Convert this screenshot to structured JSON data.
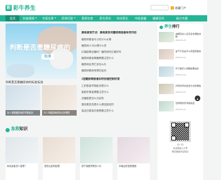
{
  "brand": {
    "logo_char": "彩",
    "name": "彩牛养生",
    "accent": "#23b595",
    "nav_active": "#168e74"
  },
  "header": {
    "favorite_label": "收藏门户"
  },
  "nav": {
    "items": [
      {
        "label": "首页",
        "active": true
      },
      {
        "label": "科普视频",
        "caret": "▼"
      },
      {
        "label": "专家文章",
        "caret": "▼"
      },
      {
        "label": "药师问答",
        "caret": "▼"
      },
      {
        "label": "营养饮食"
      },
      {
        "label": "养生资讯"
      },
      {
        "label": "科学养生"
      },
      {
        "label": "中医保健"
      },
      {
        "label": "健康百科"
      },
      {
        "label": "秘方专题"
      }
    ]
  },
  "hero": {
    "title": "判断是否患糖尿病的",
    "button": "标准",
    "caption": "判断是否患糖尿病的标准标准"
  },
  "thumbs": [
    {
      "caption": "怎么调理糖尿病的早期症状"
    },
    {
      "caption": "青少年糖尿病的特点有哪些"
    }
  ],
  "news": {
    "lead": "胰岛素泵疗法：胰岛素泵对糖尿病患者有何作用",
    "items": [
      "糖尿病患者可以吃什么水果",
      "糖尿病人可以喝什么茶",
      "红薯能降血糖吗？糖尿病吃红薯好吗",
      "糖尿病患者降糖需要注意什么",
      "糖尿病足溃烂该怎么办",
      "糖尿病眼病有哪些症状"
    ],
    "title2": "2型糖尿病患者如何合理控制饮食",
    "items2": [
      "乙肝患者早期症状是什么",
      "脂肪肝患者需要注意什么",
      "血糖高是怎么引起的",
      "胰岛素抵抗是什么原因造成的",
      "高血压患者饮食需要注意什么"
    ]
  },
  "rank": {
    "heading_prefix": "养生",
    "heading_suffix": "排行",
    "items": [
      {
        "title": "血糖高的人应该多吃哪些食物",
        "date": "2019-01-15"
      },
      {
        "title": "血气不足是什么原因导致的",
        "date": "2019-01-14"
      },
      {
        "title": "胃下垂怎么调理效果最好",
        "date": "2019-01-14"
      },
      {
        "title": "养肝护肝的最佳方法有哪些",
        "date": "2019-01-12"
      },
      {
        "title": "怎样预防老年痴呆症",
        "date": "2019-01-11"
      },
      {
        "title": "糖尿病人能吃火龙果吗",
        "date": "2019-01-10"
      }
    ]
  },
  "side_button": {
    "label": "▲"
  },
  "knowledge": {
    "heading_prefix": "急救",
    "heading_suffix": "知识",
    "cards": [
      {
        "caption": "休克患者怎么急救？"
      },
      {
        "caption": "烫伤后如何处理"
      },
      {
        "caption": "孩子误食异物怎么办"
      },
      {
        "caption": "中暑后的急救措施"
      }
    ]
  },
  "qr": {
    "line1": "扫一扫",
    "line2": "关注微信公众号",
    "line3": "每天推送养生知识"
  }
}
